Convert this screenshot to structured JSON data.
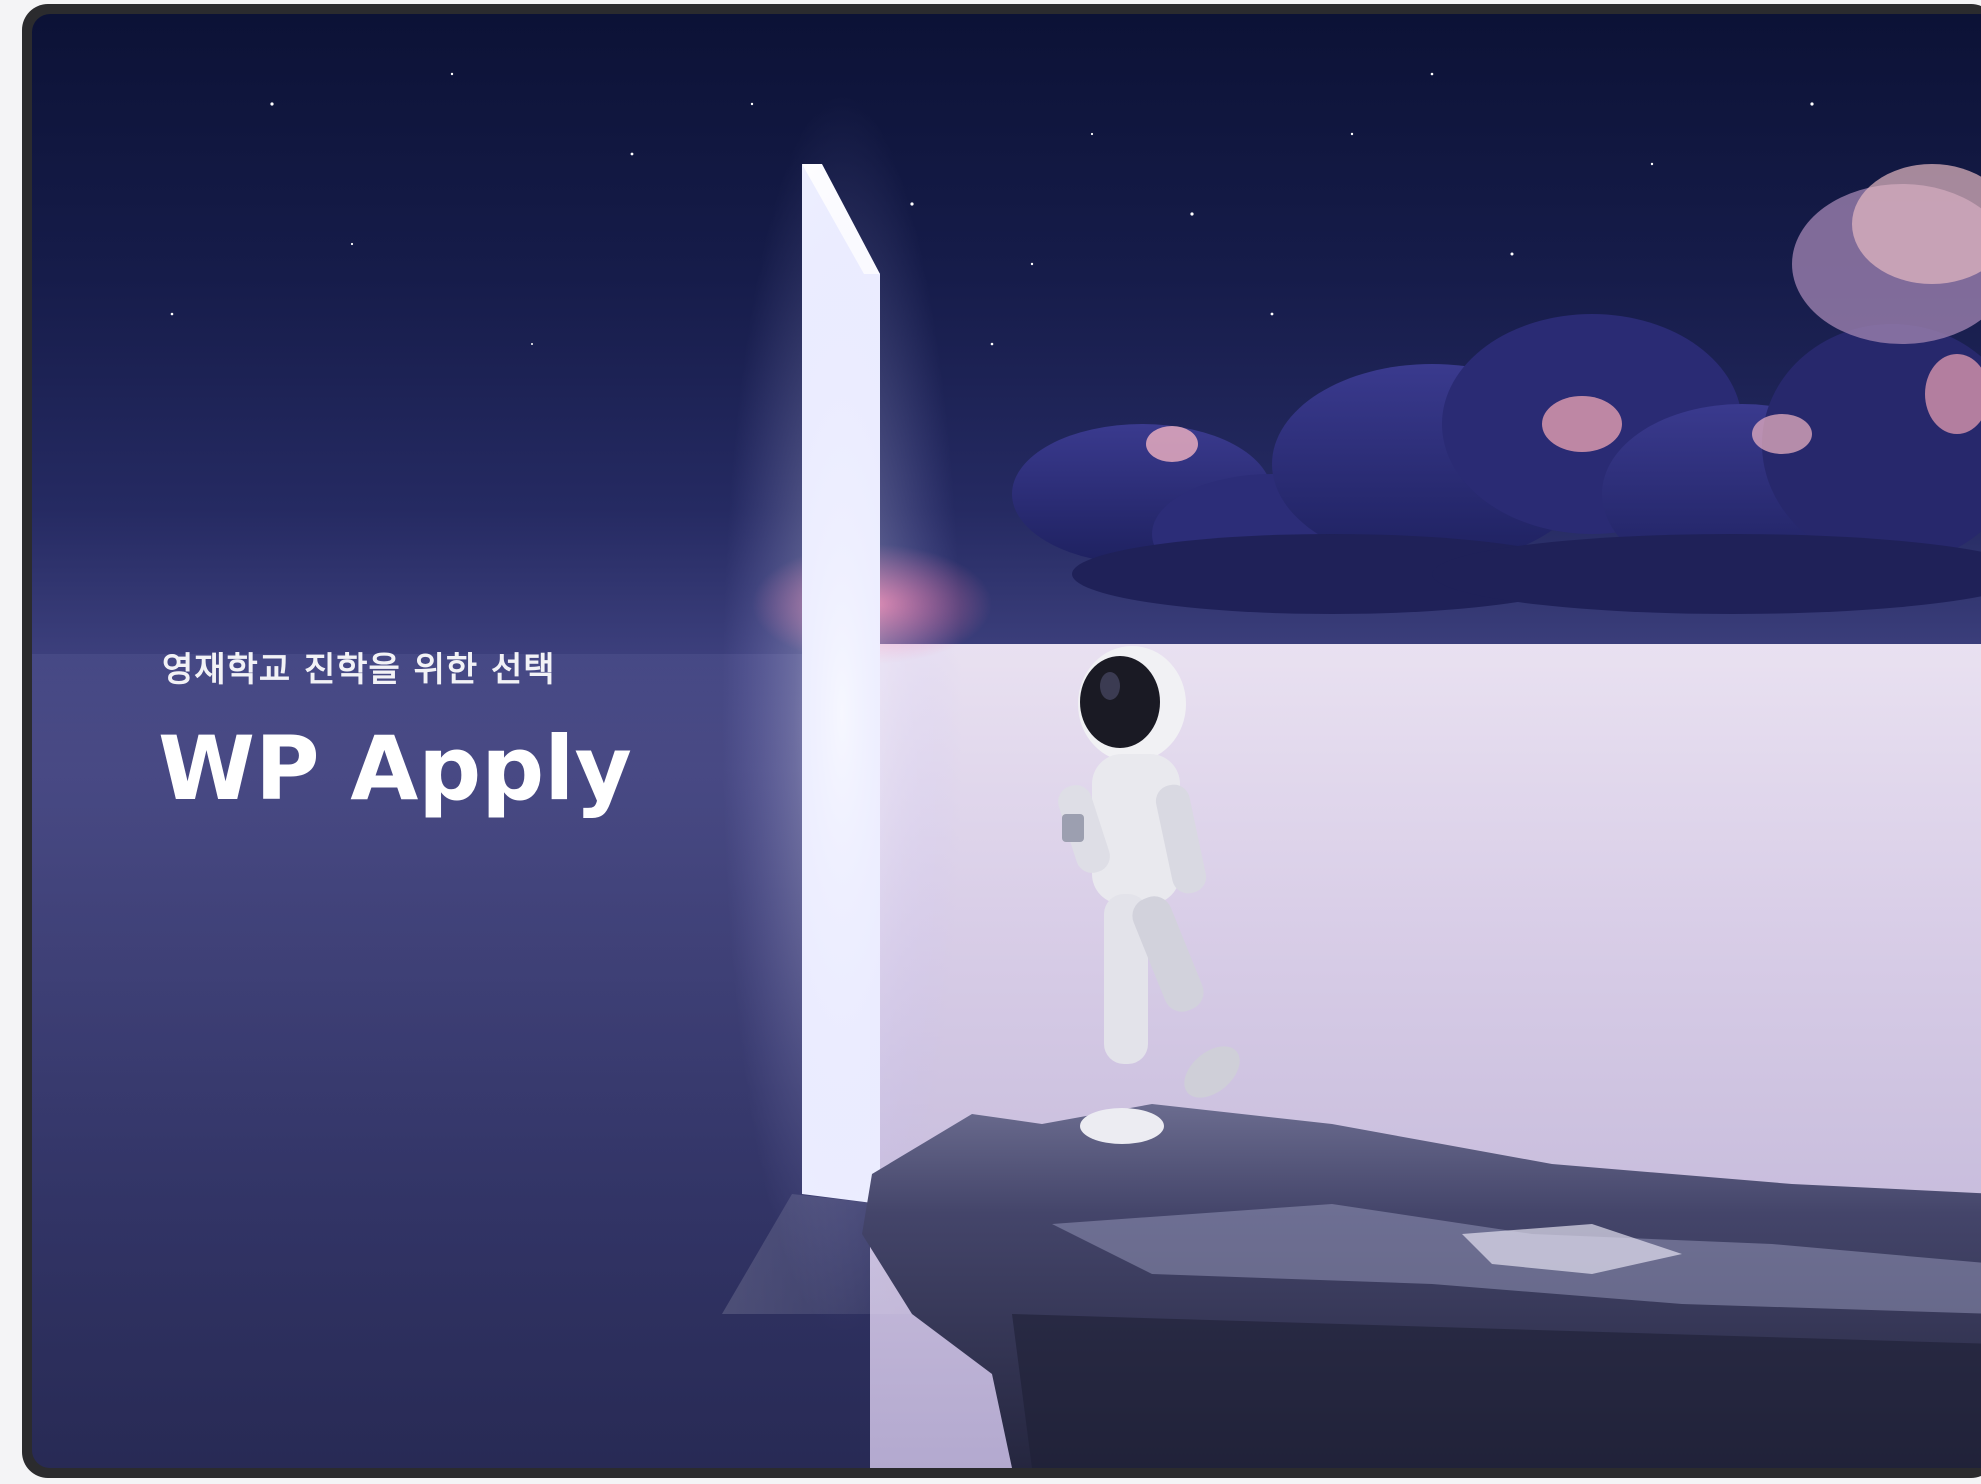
{
  "hero": {
    "tagline": "영재학교 진학을 위한 선택",
    "title": "WP Apply",
    "illustration": "astronaut-walking-through-glowing-door"
  },
  "colors": {
    "frame": "#2b2b2e",
    "sky_top": "#0c1236",
    "sea": "#d9cfe6",
    "text": "#ffffff"
  }
}
